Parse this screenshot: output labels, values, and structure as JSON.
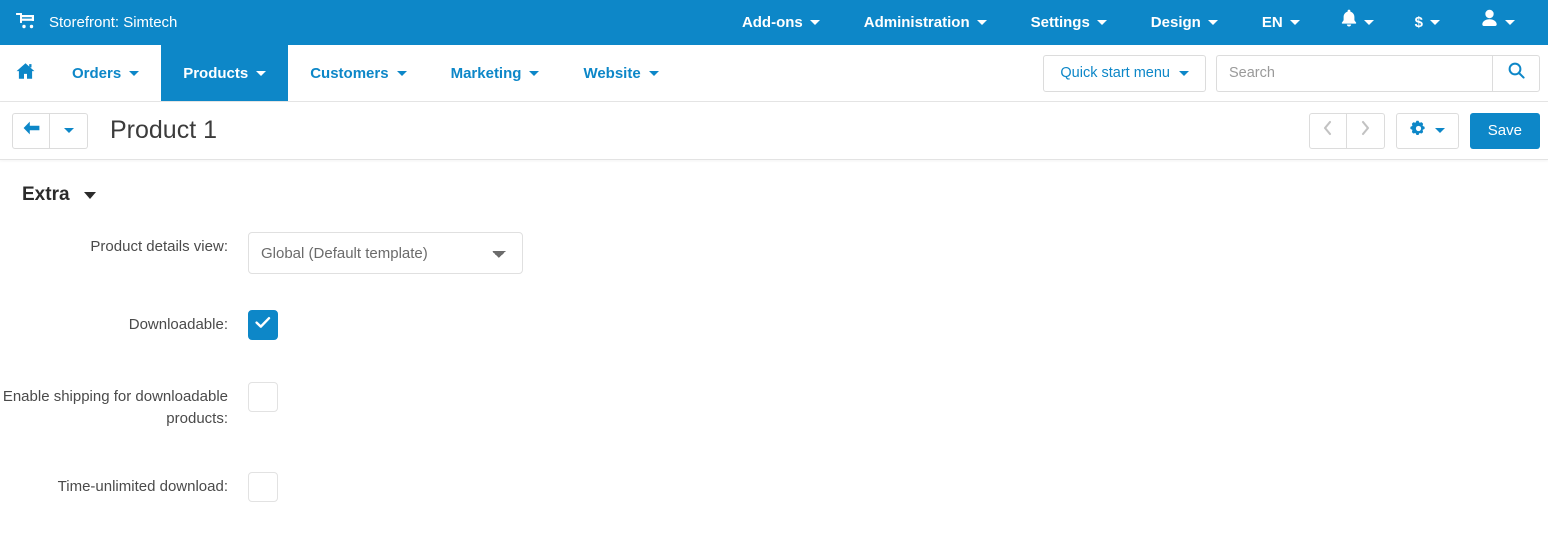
{
  "topbar": {
    "brand": "Storefront: Simtech",
    "cart_icon": "shopping-cart-icon",
    "menu": [
      {
        "label": "Add-ons",
        "has_caret": true
      },
      {
        "label": "Administration",
        "has_caret": true
      },
      {
        "label": "Settings",
        "has_caret": true
      },
      {
        "label": "Design",
        "has_caret": true
      },
      {
        "label": "EN",
        "has_caret": true
      }
    ],
    "notifications_icon": "bell-icon",
    "currency_label": "$",
    "account_icon": "user-icon",
    "background_color": "#0d87c8"
  },
  "mainnav": {
    "home_icon": "home-icon",
    "items": [
      {
        "label": "Orders",
        "active": false
      },
      {
        "label": "Products",
        "active": true
      },
      {
        "label": "Customers",
        "active": false
      },
      {
        "label": "Marketing",
        "active": false
      },
      {
        "label": "Website",
        "active": false
      }
    ],
    "quick_start_label": "Quick start menu",
    "search_placeholder": "Search",
    "search_value": "",
    "search_icon": "magnifier-icon",
    "accent_color": "#0d87c8"
  },
  "titlebar": {
    "back_icon": "arrow-left-icon",
    "back_dropdown_icon": "caret-down-icon",
    "title": "Product 1",
    "prev_icon": "chevron-left-icon",
    "next_icon": "chevron-right-icon",
    "gear_icon": "gear-icon",
    "gear_caret_icon": "caret-down-icon",
    "save_label": "Save"
  },
  "section": {
    "title": "Extra",
    "collapse_icon": "caret-down-icon"
  },
  "form": {
    "product_details_view": {
      "label": "Product details view:",
      "value": "Global (Default template)",
      "options": [
        "Global (Default template)"
      ]
    },
    "downloadable": {
      "label": "Downloadable:",
      "checked": true
    },
    "enable_shipping": {
      "label": "Enable shipping for downloadable products:",
      "checked": false
    },
    "time_unlimited_download": {
      "label": "Time-unlimited download:",
      "checked": false
    }
  }
}
